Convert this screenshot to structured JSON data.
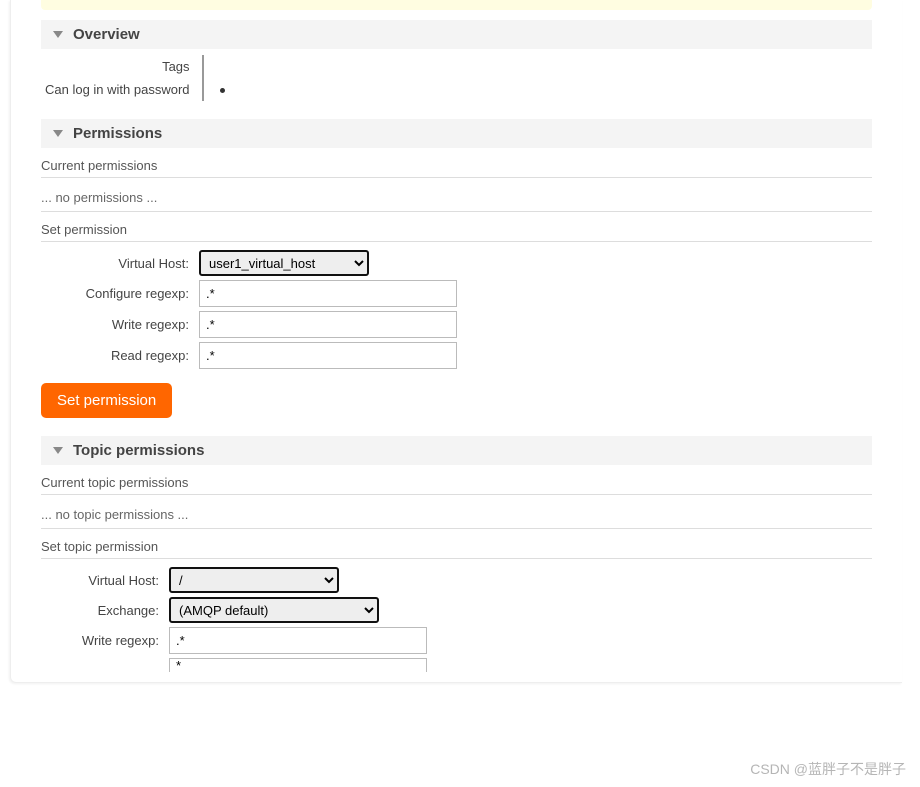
{
  "sections": {
    "overview": {
      "title": "Overview",
      "rows": {
        "tags_label": "Tags",
        "tags_value": "",
        "login_label": "Can log in with password",
        "login_value": "●"
      }
    },
    "permissions": {
      "title": "Permissions",
      "current_label": "Current permissions",
      "none_text": "... no permissions ...",
      "set_label": "Set permission",
      "form": {
        "vhost_label": "Virtual Host:",
        "vhost_value": "user1_virtual_host",
        "configure_label": "Configure regexp:",
        "configure_value": ".*",
        "write_label": "Write regexp:",
        "write_value": ".*",
        "read_label": "Read regexp:",
        "read_value": ".*",
        "submit": "Set permission"
      }
    },
    "topic_permissions": {
      "title": "Topic permissions",
      "current_label": "Current topic permissions",
      "none_text": "... no topic permissions ...",
      "set_label": "Set topic permission",
      "form": {
        "vhost_label": "Virtual Host:",
        "vhost_value": "/",
        "exchange_label": "Exchange:",
        "exchange_value": "(AMQP default)",
        "write_label": "Write regexp:",
        "write_value": ".*",
        "read_value": "*"
      }
    }
  },
  "watermark": "CSDN @蓝胖子不是胖子"
}
